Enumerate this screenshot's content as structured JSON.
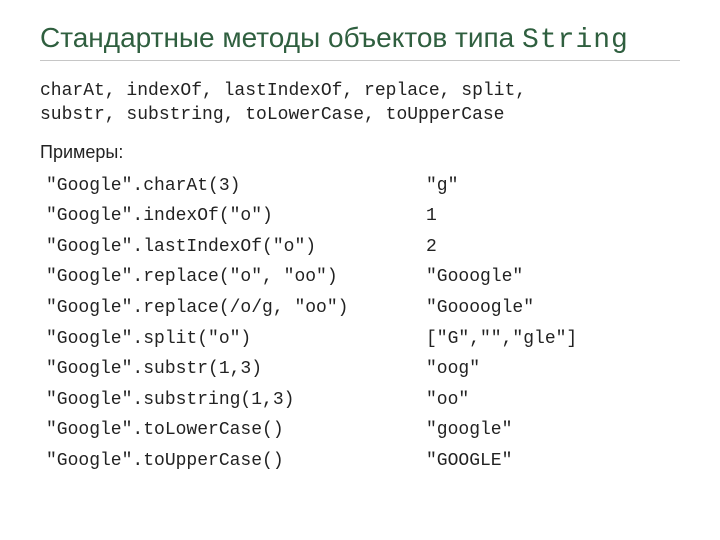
{
  "title_prefix": "Стандартные методы объектов типа ",
  "title_mono": "String",
  "methods_line1": "charAt, indexOf, lastIndexOf, replace, split,",
  "methods_line2": "substr, substring, toLowerCase, toUpperCase",
  "examples_heading": "Примеры:",
  "rows": [
    {
      "expr": "\"Google\".charAt(3)",
      "result": "\"g\""
    },
    {
      "expr": "\"Google\".indexOf(\"o\")",
      "result": "1"
    },
    {
      "expr": "\"Google\".lastIndexOf(\"o\")",
      "result": "2"
    },
    {
      "expr": "\"Google\".replace(\"o\", \"oo\")",
      "result": "\"Gooogle\""
    },
    {
      "expr": "\"Google\".replace(/o/g, \"oo\")",
      "result": "\"Goooogle\""
    },
    {
      "expr": "\"Google\".split(\"o\")",
      "result": "[\"G\",\"\",\"gle\"]"
    },
    {
      "expr": "\"Google\".substr(1,3)",
      "result": "\"oog\""
    },
    {
      "expr": "\"Google\".substring(1,3)",
      "result": "\"oo\""
    },
    {
      "expr": "\"Google\".toLowerCase()",
      "result": "\"google\""
    },
    {
      "expr": "\"Google\".toUpperCase()",
      "result": "\"GOOGLE\""
    }
  ]
}
